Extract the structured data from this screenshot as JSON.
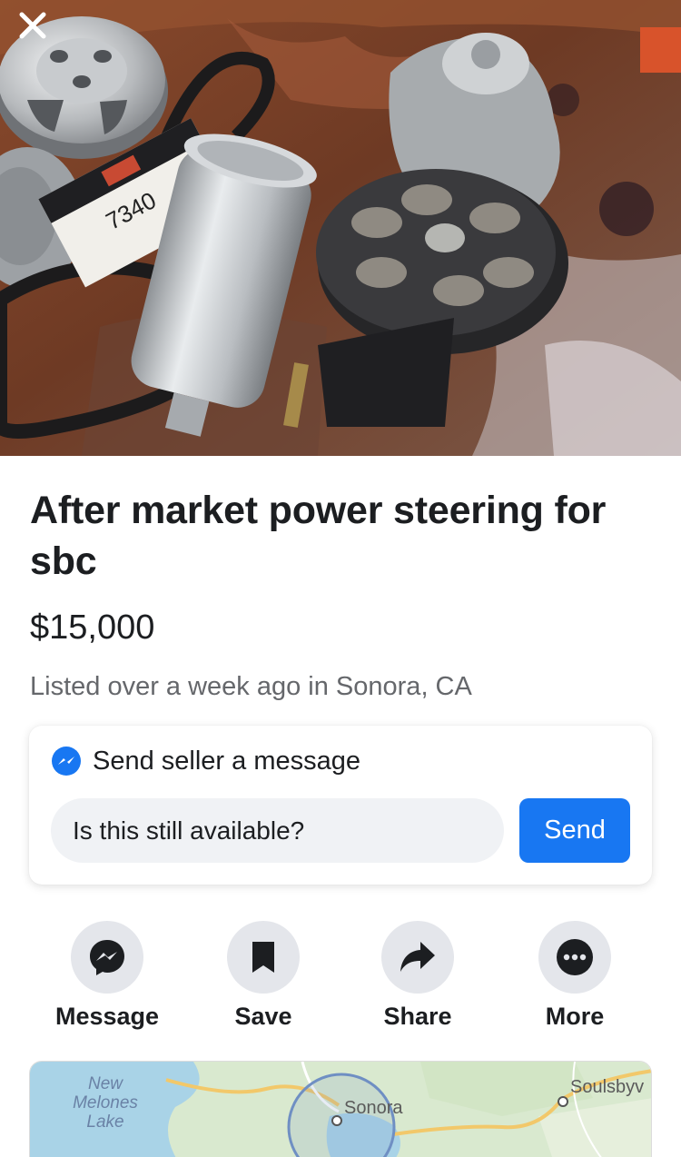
{
  "listing": {
    "title": "After market power steering for sbc",
    "price": "$15,000",
    "listed": "Listed over a week ago in Sonora, CA"
  },
  "message_box": {
    "heading": "Send seller a message",
    "input_value": "Is this still available?",
    "send_label": "Send"
  },
  "actions": [
    {
      "label": "Message",
      "icon": "messenger-icon"
    },
    {
      "label": "Save",
      "icon": "bookmark-icon"
    },
    {
      "label": "Share",
      "icon": "share-arrow-icon"
    },
    {
      "label": "More",
      "icon": "more-dots-icon"
    }
  ],
  "map": {
    "lake_label": "New\nMelones\nLake",
    "city_center": "Sonora",
    "city_right": "Soulsbyv"
  },
  "colors": {
    "accent": "#1877f2",
    "text_primary": "#1c1e21",
    "text_secondary": "#65676b",
    "button_bg": "#e4e6eb"
  }
}
